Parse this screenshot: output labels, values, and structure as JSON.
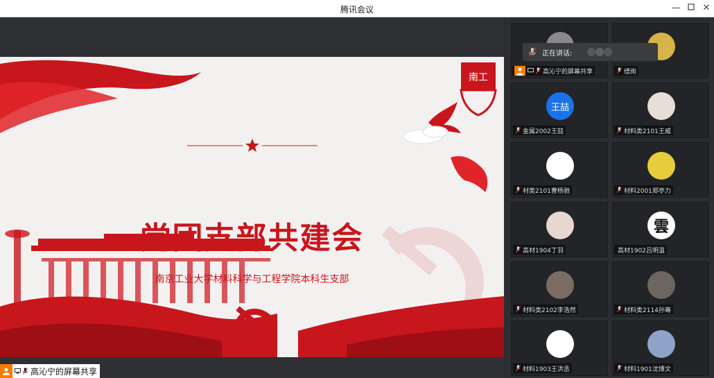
{
  "window": {
    "title": "腾讯会议"
  },
  "slide": {
    "heading": "党团支部共建会",
    "subheading": "南京工业大学材料科学与工程学院本科生支部"
  },
  "share_label": {
    "text": "高沁宁的屏幕共享"
  },
  "speaking": {
    "label": "正在讲话:"
  },
  "participants": [
    {
      "name": "高沁宁的屏幕共享",
      "avatar_text": "",
      "avatar_color": "#8a8a8a"
    },
    {
      "name": "缥雨",
      "avatar_text": "",
      "avatar_color": "#d6b44a"
    },
    {
      "name": "金属2002王喆",
      "avatar_text": "王喆",
      "avatar_color": "#1a73e8"
    },
    {
      "name": "材料类2101王威",
      "avatar_text": "",
      "avatar_color": "#e8ded8"
    },
    {
      "name": "材类2101曹杨驰",
      "avatar_text": "",
      "avatar_color": "#ffffff"
    },
    {
      "name": "材料2001郑亭力",
      "avatar_text": "",
      "avatar_color": "#e6cd3c"
    },
    {
      "name": "高材1904丁羽",
      "avatar_text": "",
      "avatar_color": "#e8d7d0"
    },
    {
      "name": "高材1902吕明温",
      "avatar_text": "雲",
      "avatar_color": "#ffffff"
    },
    {
      "name": "材料类2102李浩然",
      "avatar_text": "",
      "avatar_color": "#7a6c62"
    },
    {
      "name": "材料类2114孙骞",
      "avatar_text": "",
      "avatar_color": "#6c6660"
    },
    {
      "name": "材料1903王洪丞",
      "avatar_text": "",
      "avatar_color": "#ffffff"
    },
    {
      "name": "材料1901沈博文",
      "avatar_text": "",
      "avatar_color": "#8da3c8"
    }
  ],
  "colors": {
    "accent_red": "#c8161d",
    "host_orange": "#f57c00",
    "sidebar_bg": "#2b2d30"
  }
}
